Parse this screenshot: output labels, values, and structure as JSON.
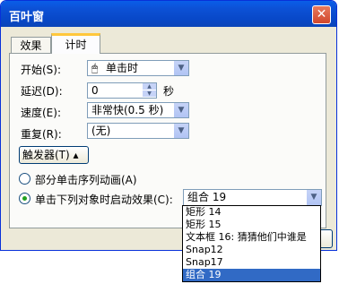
{
  "window": {
    "title": "百叶窗",
    "close_glyph": "✕"
  },
  "tabs": [
    {
      "label": "效果"
    },
    {
      "label": "计时"
    }
  ],
  "start": {
    "label": "开始(S):",
    "value": "单击时"
  },
  "delay": {
    "label": "延迟(D):",
    "value": "0",
    "unit": "秒"
  },
  "speed": {
    "label": "速度(E):",
    "value": "非常快(0.5 秒)"
  },
  "repeat": {
    "label": "重复(R):",
    "value": "(无)"
  },
  "trigger": {
    "label": "触发器(T) ▴"
  },
  "radio1": {
    "label": "部分单击序列动画(A)"
  },
  "radio2": {
    "label": "单击下列对象时启动效果(C):",
    "value": "组合 19"
  },
  "list": [
    "矩形 14",
    "矩形 15",
    "文本框 16: 猜猜他们中谁是",
    "Snap12",
    "Snap17",
    "组合 19"
  ]
}
